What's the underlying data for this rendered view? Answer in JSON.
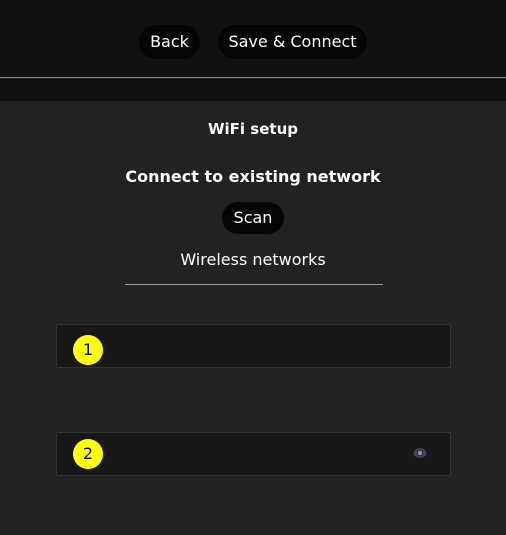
{
  "header": {
    "back_label": "Back",
    "save_connect_label": "Save & Connect"
  },
  "main": {
    "title": "WiFi setup",
    "subtitle": "Connect to existing network",
    "scan_label": "Scan",
    "networks_label": "Wireless networks"
  },
  "fields": [
    {
      "badge": "1",
      "value": "",
      "icon": ""
    },
    {
      "badge": "2",
      "value": "",
      "icon": "eye-icon"
    }
  ],
  "colors": {
    "badge": "#ffff00",
    "background": "#222222",
    "topbar": "#111111",
    "button": "#050505"
  }
}
